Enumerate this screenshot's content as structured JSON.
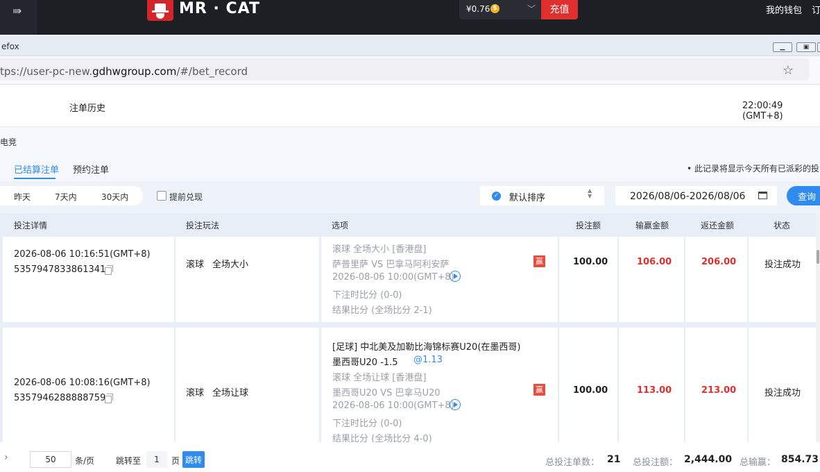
{
  "app": {
    "brand": "MR · CAT",
    "balance": "¥0.76",
    "coin_symbol": "$",
    "recharge_label": "充值",
    "wallet_label": "我的钱包",
    "orders_label_truncated": "订"
  },
  "browser": {
    "window_title": "efox",
    "url_prefix": "tps://user-pc-new.",
    "url_domain": "gdhwgroup.com",
    "url_path": "/#/bet_record",
    "win_minimize": "▭",
    "win_restore": "⧉",
    "win_close_partial": "✕"
  },
  "page": {
    "title": "注单历史",
    "clock": "22:00:49 (GMT+8)",
    "category": "电竞",
    "tabs": [
      {
        "label": "已结算注单",
        "active": true
      },
      {
        "label": "预约注单",
        "active": false
      }
    ],
    "notice": "• 此记录将显示今天所有已派彩的投"
  },
  "filters": {
    "ranges": [
      "昨天",
      "7天内",
      "30天内"
    ],
    "early_cashout_label": "提前兑现",
    "sort_label": "默认排序",
    "date_range": "2026/08/06-2026/08/06",
    "query_label": "查询"
  },
  "table": {
    "headers": {
      "detail": "投注详情",
      "play": "投注玩法",
      "options": "选项",
      "stake": "投注额",
      "winloss": "输赢金额",
      "refund": "返还金额",
      "status": "状态"
    },
    "rows": [
      {
        "time": "2026-08-06 10:16:51(GMT+8)",
        "order_no": "5357947833861341",
        "play_type": "滚球",
        "play_market": "全场大小",
        "league": "",
        "pick": "",
        "odds": "",
        "market": "滚球 全场大小 [香港盘]",
        "teams": "萨普里萨 VS 巴拿马阿利安萨",
        "match_time": "2026-08-06 10:00(GMT+8)",
        "score_at_bet": "下注时比分 (0-0)",
        "result": "结果比分 (全场比分 2-1)",
        "result_badge": "赢",
        "stake": "100.00",
        "winloss": "106.00",
        "refund": "206.00",
        "status": "投注成功"
      },
      {
        "time": "2026-08-06 10:08:16(GMT+8)",
        "order_no": "5357946288888759",
        "play_type": "滚球",
        "play_market": "全场让球",
        "league": "[足球] 中北美及加勒比海锦标赛U20(在墨西哥)",
        "pick": "墨西哥U20 -1.5",
        "odds": "@1.13",
        "market": "滚球 全场让球 [香港盘]",
        "teams": "墨西哥U20 VS 巴拿马U20",
        "match_time": "2026-08-06 10:00(GMT+8)",
        "score_at_bet": "下注时比分 (0-0)",
        "result": "结果比分 (全场比分 4-0)",
        "result_badge": "赢",
        "stake": "100.00",
        "winloss": "113.00",
        "refund": "213.00",
        "status": "投注成功"
      }
    ]
  },
  "footer": {
    "page_size": "50",
    "per_page_label": "条/页",
    "goto_label": "跳转至",
    "goto_page": "1",
    "page_unit": "页",
    "jump_label": "跳转",
    "total_count_label": "总投注单数：",
    "total_count": "21",
    "total_stake_label": "总投注额：",
    "total_stake": "2,444.00",
    "total_winloss_label": "总输赢：",
    "total_winloss": "854.73"
  },
  "colors": {
    "accent": "#2f8bf0",
    "win_red": "#e02f2f",
    "topbar": "#1e1f25"
  }
}
